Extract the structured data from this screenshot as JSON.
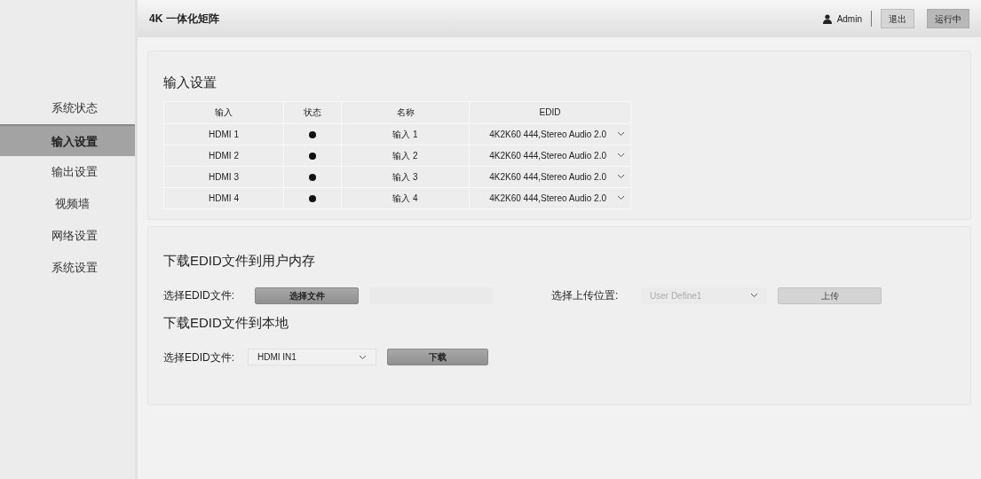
{
  "header": {
    "title": "4K 一体化矩阵",
    "user": "Admin",
    "logout": "退出",
    "status": "运行中"
  },
  "sidebar": {
    "items": [
      {
        "label": "系统状态",
        "selected": false
      },
      {
        "label": "输入设置",
        "selected": true
      },
      {
        "label": "输出设置",
        "selected": false
      },
      {
        "label": "视频墙",
        "selected": false
      },
      {
        "label": "网络设置",
        "selected": false
      },
      {
        "label": "系统设置",
        "selected": false
      }
    ]
  },
  "input_settings": {
    "title": "输入设置",
    "columns": [
      "输入",
      "状态",
      "名称",
      "EDID"
    ],
    "rows": [
      {
        "input": "HDMI 1",
        "connected": true,
        "name": "输入 1",
        "edid": "4K2K60 444,Stereo Audio 2.0"
      },
      {
        "input": "HDMI 2",
        "connected": true,
        "name": "输入 2",
        "edid": "4K2K60 444,Stereo Audio 2.0"
      },
      {
        "input": "HDMI 3",
        "connected": true,
        "name": "输入 3",
        "edid": "4K2K60 444,Stereo Audio 2.0"
      },
      {
        "input": "HDMI 4",
        "connected": true,
        "name": "输入 4",
        "edid": "4K2K60 444,Stereo Audio 2.0"
      }
    ]
  },
  "upload": {
    "title": "下载EDID文件到用户内存",
    "file_label": "选择EDID文件:",
    "file_button": "选择文件",
    "location_label": "选择上传位置:",
    "location_value": "User Define1",
    "upload_button": "上传"
  },
  "download": {
    "title": "下载EDID文件到本地",
    "file_label": "选择EDID文件:",
    "file_value": "HDMI IN1",
    "download_button": "下载"
  }
}
